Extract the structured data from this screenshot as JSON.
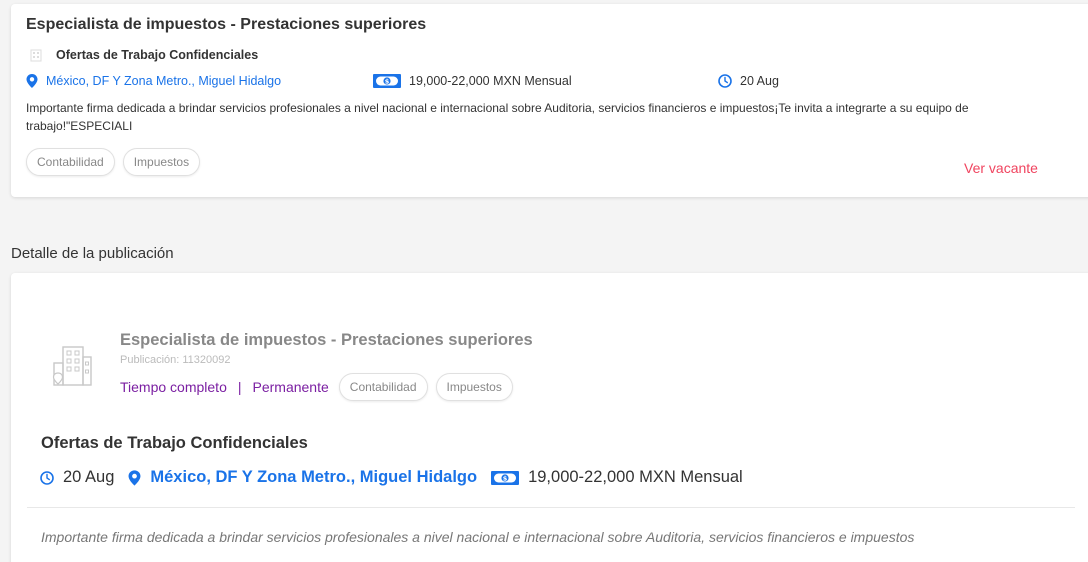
{
  "top_card": {
    "title": "Especialista de impuestos - Prestaciones superiores",
    "company": "Ofertas de Trabajo Confidenciales",
    "location": "México, DF Y Zona Metro., Miguel Hidalgo",
    "salary": "19,000-22,000 MXN Mensual",
    "date": "20 Aug",
    "description": "Importante firma dedicada a brindar servicios profesionales a nivel nacional e internacional sobre Auditoria, servicios financieros e impuestos¡Te invita a integrarte a su equipo de trabajo!\"ESPECIALI",
    "tags": [
      "Contabilidad",
      "Impuestos"
    ],
    "cta": "Ver vacante"
  },
  "section": {
    "title": "Detalle de la publicación"
  },
  "detail": {
    "title": "Especialista de impuestos - Prestaciones superiores",
    "publication": "Publicación: 11320092",
    "job_type": "Tiempo completo",
    "separator": "|",
    "contract": "Permanente",
    "tags": [
      "Contabilidad",
      "Impuestos"
    ],
    "company": "Ofertas de Trabajo Confidenciales",
    "date": "20 Aug",
    "location": "México, DF Y Zona Metro., Miguel Hidalgo",
    "salary": "19,000-22,000 MXN Mensual",
    "description": "Importante firma dedicada a brindar servicios profesionales a nivel nacional e internacional sobre Auditoria, servicios financieros e impuestos"
  },
  "colors": {
    "link": "#1a73e8",
    "accent_red": "#f0445f",
    "purple": "#7b1fa2"
  },
  "icons": [
    "building-icon",
    "location-pin-icon",
    "money-icon",
    "clock-icon"
  ]
}
